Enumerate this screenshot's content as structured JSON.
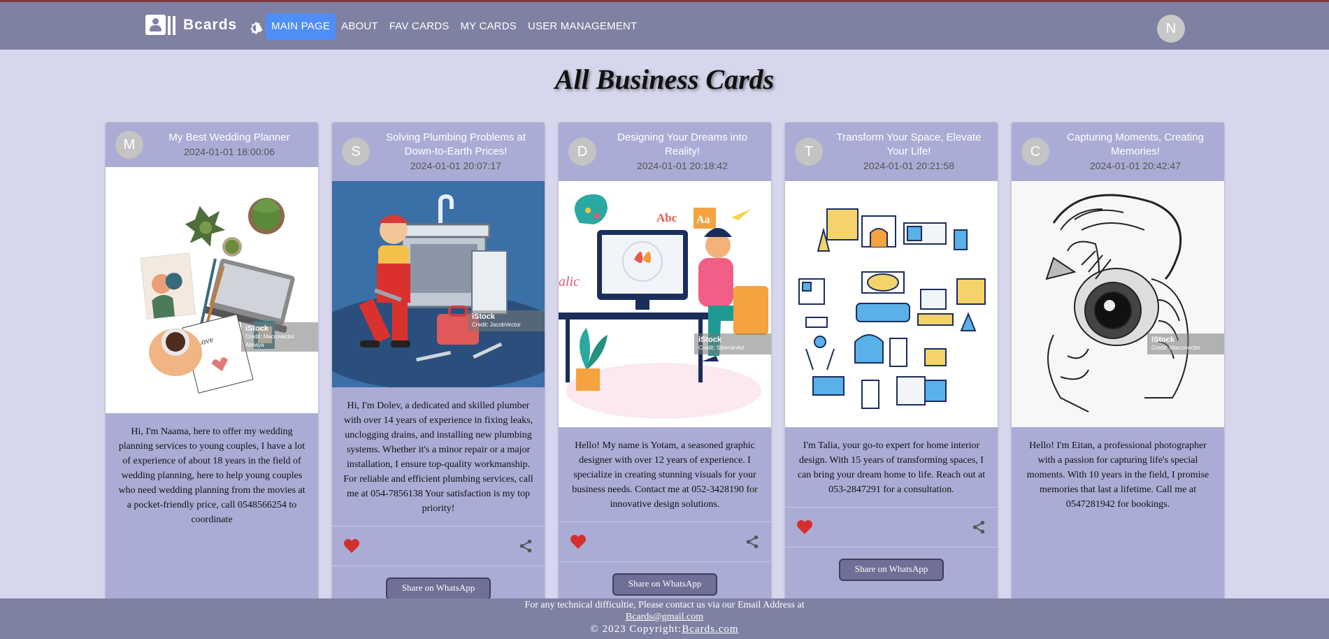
{
  "header": {
    "brand": "Bcards",
    "nav": [
      {
        "label": "MAIN PAGE",
        "active": true
      },
      {
        "label": "ABOUT",
        "active": false
      },
      {
        "label": "FAV CARDS",
        "active": false
      },
      {
        "label": "MY CARDS",
        "active": false
      },
      {
        "label": "USER MANAGEMENT",
        "active": false
      }
    ],
    "avatar_letter": "N",
    "icons": [
      "logo-icon",
      "theme-toggle-icon"
    ]
  },
  "page_title": "All Business Cards",
  "cards": [
    {
      "letter": "M",
      "title": "My Best Wedding Planner",
      "date": "2024-01-01 18:00:06",
      "image": "wedding-planner-illustration",
      "watermark": "iStock",
      "watermark_credit": "Credit: Macrovector Almaya",
      "description": "Hi, I'm Naama, here to offer my wedding planning services to young couples, I have a lot of experience of about 18 years in the field of wedding planning, here to help young couples who need wedding planning from the movies at a pocket-friendly price, call 0548566254 to coordinate",
      "has_actions": false
    },
    {
      "letter": "S",
      "title": "Solving Plumbing Problems at Down-to-Earth Prices!",
      "date": "2024-01-01 20:07:17",
      "image": "plumber-illustration",
      "watermark": "iStock",
      "watermark_credit": "Credit: JacobVector",
      "description": "Hi, I'm Dolev, a dedicated and skilled plumber with over 14 years of experience in fixing leaks, unclogging drains, and installing new plumbing systems. Whether it's a minor repair or a major installation, I ensure top-quality workmanship. For reliable and efficient plumbing services, call me at 054-7856138 Your satisfaction is my top priority!",
      "has_actions": true,
      "whatsapp_label": "Share on WhatsApp"
    },
    {
      "letter": "D",
      "title": "Designing Your Dreams into Reality!",
      "date": "2024-01-01 20:18:42",
      "image": "graphic-designer-illustration",
      "watermark": "iStock",
      "watermark_credit": "Credit: SiberianArt",
      "description": "Hello! My name is Yotam, a seasoned graphic designer with over 12 years of experience. I specialize in creating stunning visuals for your business needs. Contact me at 052-3428190 for innovative design solutions.",
      "has_actions": true,
      "whatsapp_label": "Share on WhatsApp"
    },
    {
      "letter": "T",
      "title": "Transform Your Space, Elevate Your Life!",
      "date": "2024-01-01 20:21:58",
      "image": "interior-design-icons",
      "watermark": "",
      "watermark_credit": "",
      "description": "I'm Talia, your go-to expert for home interior design. With 15 years of transforming spaces, I can bring your dream home to life. Reach out at 053-2847291 for a consultation.",
      "has_actions": true,
      "whatsapp_label": "Share on WhatsApp"
    },
    {
      "letter": "C",
      "title": "Capturing Moments, Creating Memories!",
      "date": "2024-01-01 20:42:47",
      "image": "photographer-sketch",
      "watermark": "iStock",
      "watermark_credit": "Credit: Macrovector",
      "description": "Hello! I'm Eitan, a professional photographer with a passion for capturing life's special moments. With 10 years in the field, I promise memories that last a lifetime. Call me at 0547281942 for bookings.",
      "has_actions": false
    }
  ],
  "colors": {
    "header_bg": "#7f81a3",
    "page_bg": "#d6d7ec",
    "card_bg": "#abacd5",
    "nav_active": "#4f8ef7",
    "heart": "#d32f2f"
  },
  "footer": {
    "line1": "For any technical difficultie, Please contact us via our Email Address at",
    "email": "Bcards@gmail.com",
    "copyright_prefix": "© 2023 Copyright:",
    "copyright_link": "Bcards.com"
  }
}
